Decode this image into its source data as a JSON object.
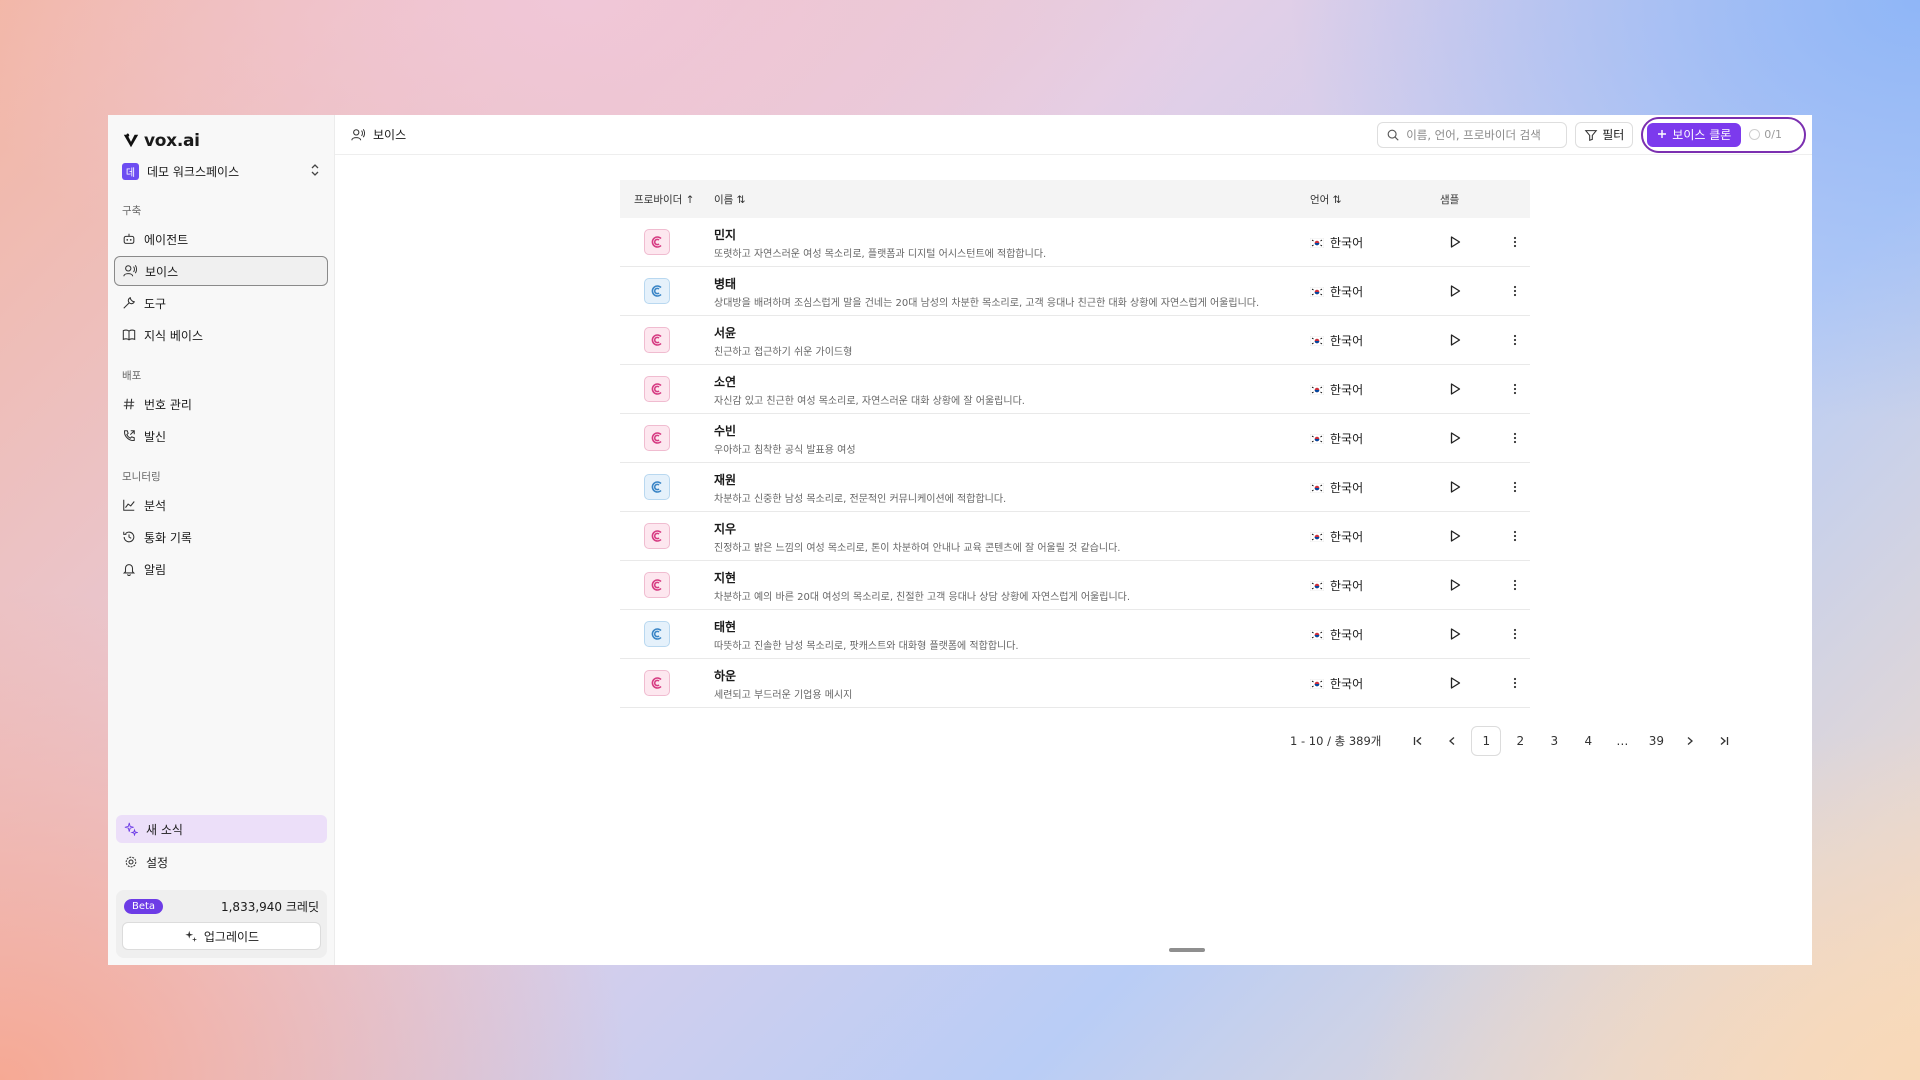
{
  "app": {
    "logo_text": "vox.ai"
  },
  "workspace": {
    "badge": "데",
    "name": "데모 워크스페이스"
  },
  "sidebar": {
    "sections": [
      {
        "label": "구축",
        "items": [
          {
            "label": "에이전트",
            "icon": "robot-icon"
          },
          {
            "label": "보이스",
            "icon": "voice-icon",
            "active": true
          },
          {
            "label": "도구",
            "icon": "wrench-icon"
          },
          {
            "label": "지식 베이스",
            "icon": "book-icon"
          }
        ]
      },
      {
        "label": "배포",
        "items": [
          {
            "label": "번호 관리",
            "icon": "hash-icon"
          },
          {
            "label": "발신",
            "icon": "phone-outgoing-icon"
          }
        ]
      },
      {
        "label": "모니터링",
        "items": [
          {
            "label": "분석",
            "icon": "chart-icon"
          },
          {
            "label": "통화 기록",
            "icon": "history-icon"
          },
          {
            "label": "알림",
            "icon": "bell-icon"
          }
        ]
      }
    ],
    "news_label": "새 소식",
    "settings_label": "설정",
    "beta_label": "Beta",
    "credits": "1,833,940 크레딧",
    "upgrade_label": "업그레이드"
  },
  "header": {
    "breadcrumb": "보이스",
    "search_placeholder": "이름, 언어, 프로바이더 검색",
    "filter_label": "필터",
    "clone_label": "보이스 클론",
    "clone_count": "0/1"
  },
  "table": {
    "columns": {
      "provider": "프로바이더",
      "name": "이름",
      "language": "언어",
      "sample": "샘플"
    },
    "rows": [
      {
        "name": "민지",
        "desc": "또렷하고 자연스러운 여성 목소리로, 플랫폼과 디지털 어시스턴트에 적합합니다.",
        "lang": "한국어",
        "provider": "pink"
      },
      {
        "name": "병태",
        "desc": "상대방을 배려하며 조심스럽게 말을 건네는 20대 남성의 차분한 목소리로, 고객 응대나 친근한 대화 상황에 자연스럽게 어울립니다.",
        "lang": "한국어",
        "provider": "blue"
      },
      {
        "name": "서윤",
        "desc": "친근하고 접근하기 쉬운 가이드형",
        "lang": "한국어",
        "provider": "pink"
      },
      {
        "name": "소연",
        "desc": "자신감 있고 친근한 여성 목소리로, 자연스러운 대화 상황에 잘 어울립니다.",
        "lang": "한국어",
        "provider": "pink"
      },
      {
        "name": "수빈",
        "desc": "우아하고 침착한 공식 발표용 여성",
        "lang": "한국어",
        "provider": "pink"
      },
      {
        "name": "재원",
        "desc": "차분하고 신중한 남성 목소리로, 전문적인 커뮤니케이션에 적합합니다.",
        "lang": "한국어",
        "provider": "blue"
      },
      {
        "name": "지우",
        "desc": "진정하고 밝은 느낌의 여성 목소리로, 톤이 차분하여 안내나 교육 콘텐츠에 잘 어울릴 것 같습니다.",
        "lang": "한국어",
        "provider": "pink"
      },
      {
        "name": "지현",
        "desc": "차분하고 예의 바른 20대 여성의 목소리로, 친절한 고객 응대나 상담 상황에 자연스럽게 어울립니다.",
        "lang": "한국어",
        "provider": "pink"
      },
      {
        "name": "태현",
        "desc": "따뜻하고 진솔한 남성 목소리로, 팟캐스트와 대화형 플랫폼에 적합합니다.",
        "lang": "한국어",
        "provider": "blue"
      },
      {
        "name": "하운",
        "desc": "세련되고 부드러운 기업용 메시지",
        "lang": "한국어",
        "provider": "pink"
      }
    ]
  },
  "pagination": {
    "summary": "1 - 10 / 총 389개",
    "pages": [
      "1",
      "2",
      "3",
      "4",
      "…",
      "39"
    ],
    "current": "1"
  },
  "colors": {
    "accent": "#7c3aed",
    "beta": "#6d3ce6"
  }
}
